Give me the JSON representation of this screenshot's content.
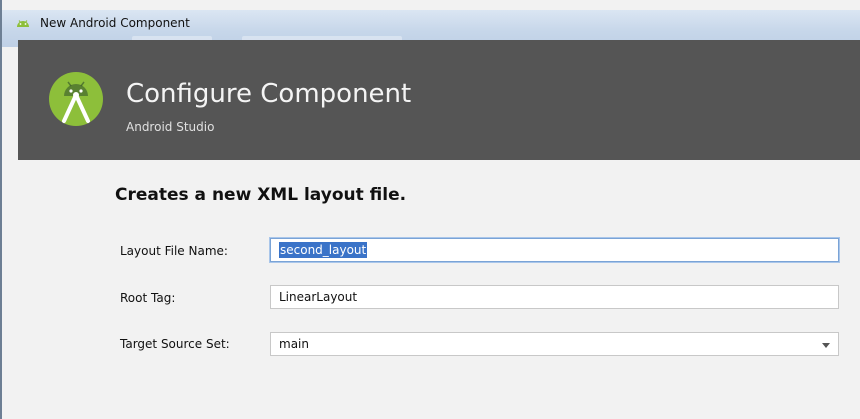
{
  "window": {
    "title": "New Android Component"
  },
  "header": {
    "title": "Configure Component",
    "subtitle": "Android Studio",
    "logo_icon": "android-studio-logo-icon",
    "background": "#555555"
  },
  "form": {
    "heading": "Creates a new XML layout file.",
    "fields": {
      "layout_file_name": {
        "label": "Layout File Name:",
        "value": "second_layout"
      },
      "root_tag": {
        "label": "Root Tag:",
        "value": "LinearLayout"
      },
      "target_source_set": {
        "label": "Target Source Set:",
        "value": "main"
      }
    }
  },
  "colors": {
    "selection": "#3a73c8",
    "focus_border": "#7aa3d6",
    "logo_green": "#8dbf3a"
  }
}
